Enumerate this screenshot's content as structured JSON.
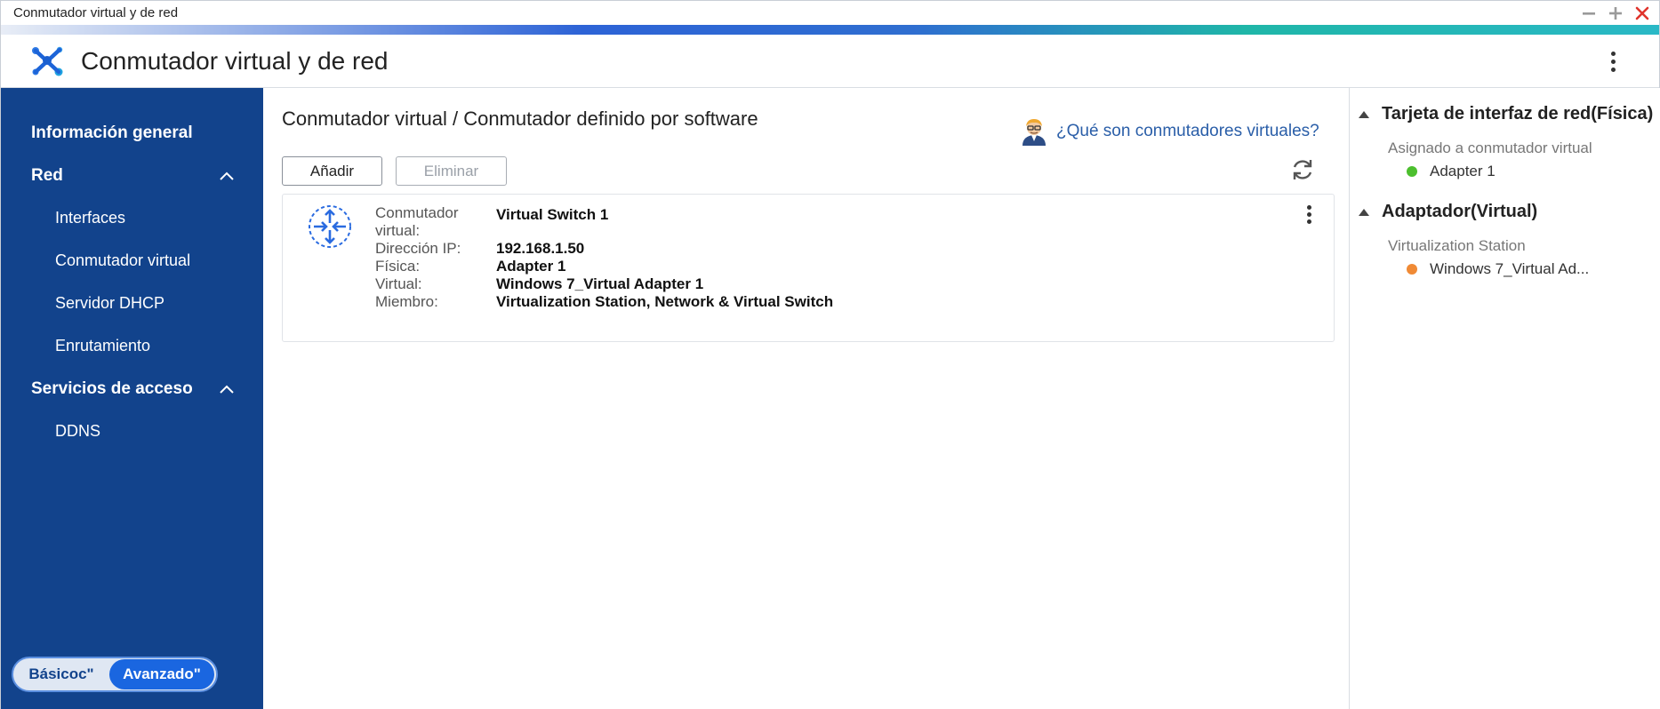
{
  "window": {
    "title": "Conmutador virtual y de red"
  },
  "app": {
    "title": "Conmutador virtual y de red"
  },
  "sidebar": {
    "items": [
      {
        "label": "Información general"
      },
      {
        "label": "Red"
      },
      {
        "label": "Interfaces"
      },
      {
        "label": "Conmutador virtual"
      },
      {
        "label": "Servidor DHCP"
      },
      {
        "label": "Enrutamiento"
      },
      {
        "label": "Servicios de acceso"
      },
      {
        "label": "DDNS"
      }
    ],
    "mode": {
      "basic": "Básicoc\"",
      "advanced": "Avanzado\""
    }
  },
  "main": {
    "title": "Conmutador virtual / Conmutador definido por software",
    "help_link": "¿Qué son conmutadores virtuales?",
    "add_button": "Añadir",
    "delete_button": "Eliminar",
    "switch_card": {
      "labels": {
        "switch": "Conmutador virtual:",
        "ip": "Dirección IP:",
        "physical": "Física:",
        "virtual": "Virtual:",
        "member": "Miembro:"
      },
      "values": {
        "switch": "Virtual Switch 1",
        "ip": "192.168.1.50",
        "physical": "Adapter 1",
        "virtual": "Windows 7_Virtual Adapter 1",
        "member": "Virtualization Station, Network & Virtual Switch"
      }
    }
  },
  "right_panel": {
    "sections": [
      {
        "title": "Tarjeta de interfaz de red(Física)",
        "subtitle": "Asignado a conmutador virtual",
        "adapters": [
          {
            "name": "Adapter 1",
            "color": "#4cbf2e"
          }
        ]
      },
      {
        "title": "Adaptador(Virtual)",
        "subtitle": "Virtualization Station",
        "adapters": [
          {
            "name": "Windows 7_Virtual Ad...",
            "color": "#f08a35"
          }
        ]
      }
    ]
  },
  "colors": {
    "sidebar": "#12438c",
    "accent": "#1a66e0",
    "link": "#2a5ea8"
  },
  "icons": [
    "minimize-icon",
    "maximize-icon",
    "close-icon",
    "app-logo-icon",
    "more-vert-icon",
    "chevron-up-icon",
    "help-avatar-icon",
    "refresh-icon",
    "switch-icon",
    "collapse-triangle-icon"
  ]
}
